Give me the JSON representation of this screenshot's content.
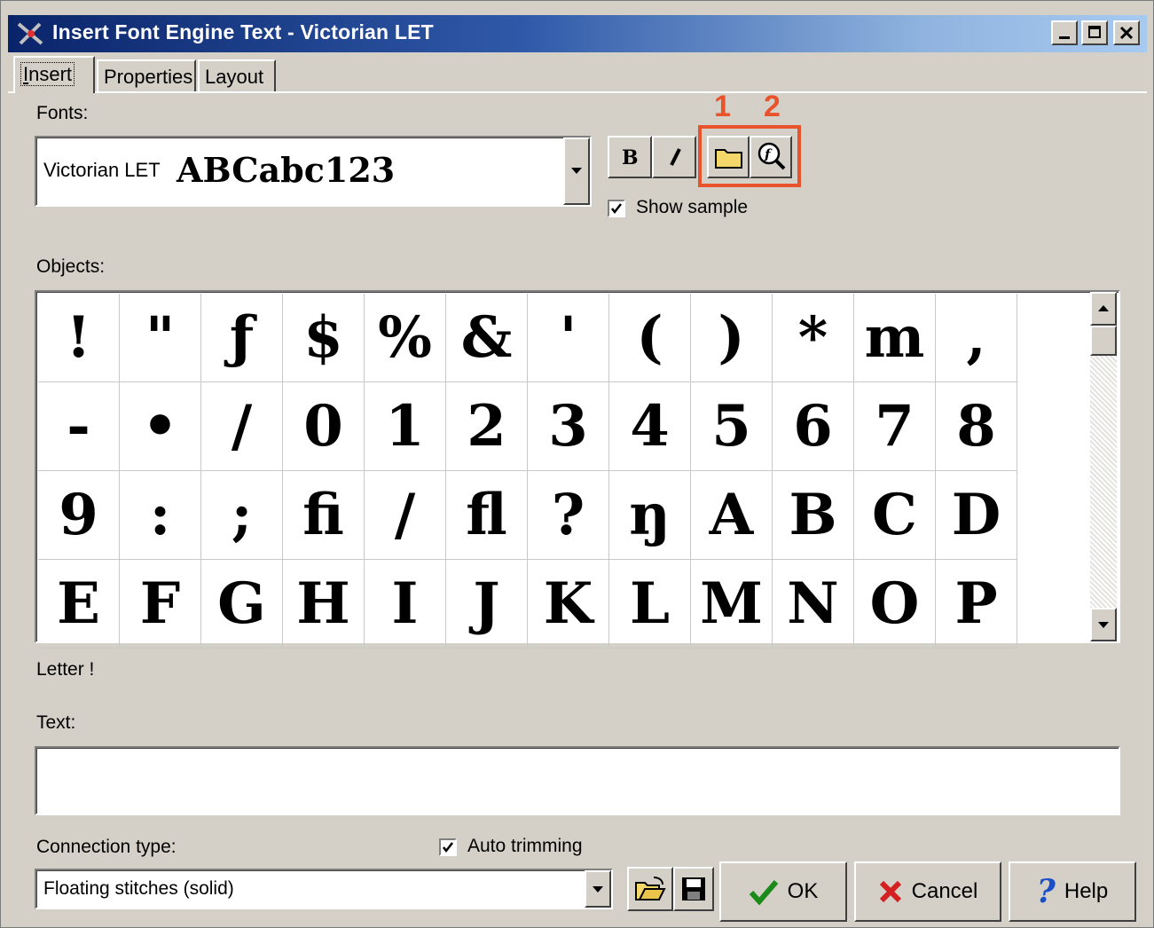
{
  "window": {
    "title": "Insert Font Engine Text - Victorian LET"
  },
  "tabs": [
    {
      "label": "Insert",
      "key": "I"
    },
    {
      "label": "Properties",
      "key": "P"
    },
    {
      "label": "Layout",
      "key": "L"
    }
  ],
  "fonts": {
    "label": "Fonts:",
    "selected_font": "Victorian LET",
    "sample": "ABCabc123",
    "bold_label": "B",
    "italic_label": "I",
    "show_sample_label": "Show sample",
    "show_sample_checked": true
  },
  "annotations": {
    "marker_1": "1",
    "marker_2": "2",
    "highlight_color": "#e8532b"
  },
  "objects": {
    "label": "Objects:",
    "glyphs": [
      "!",
      "\"",
      "ƒ",
      "$",
      "%",
      "&",
      "'",
      "(",
      ")",
      "*",
      "m",
      ",",
      "-",
      "•",
      "/",
      "0",
      "1",
      "2",
      "3",
      "4",
      "5",
      "6",
      "7",
      "8",
      "9",
      ":",
      ";",
      "fi",
      "/",
      "fl",
      "?",
      "ŋ",
      "A",
      "B",
      "C",
      "D",
      "E",
      "F",
      "G",
      "H",
      "I",
      "J",
      "K",
      "L",
      "M",
      "N",
      "O",
      "P"
    ],
    "status": "Letter !"
  },
  "text": {
    "label": "Text:",
    "value": ""
  },
  "connection": {
    "label": "Connection type:",
    "value": "Floating stitches (solid)",
    "auto_trimming_label": "Auto trimming",
    "auto_trimming_checked": true
  },
  "buttons": {
    "ok": "OK",
    "cancel": "Cancel",
    "help": "Help"
  }
}
